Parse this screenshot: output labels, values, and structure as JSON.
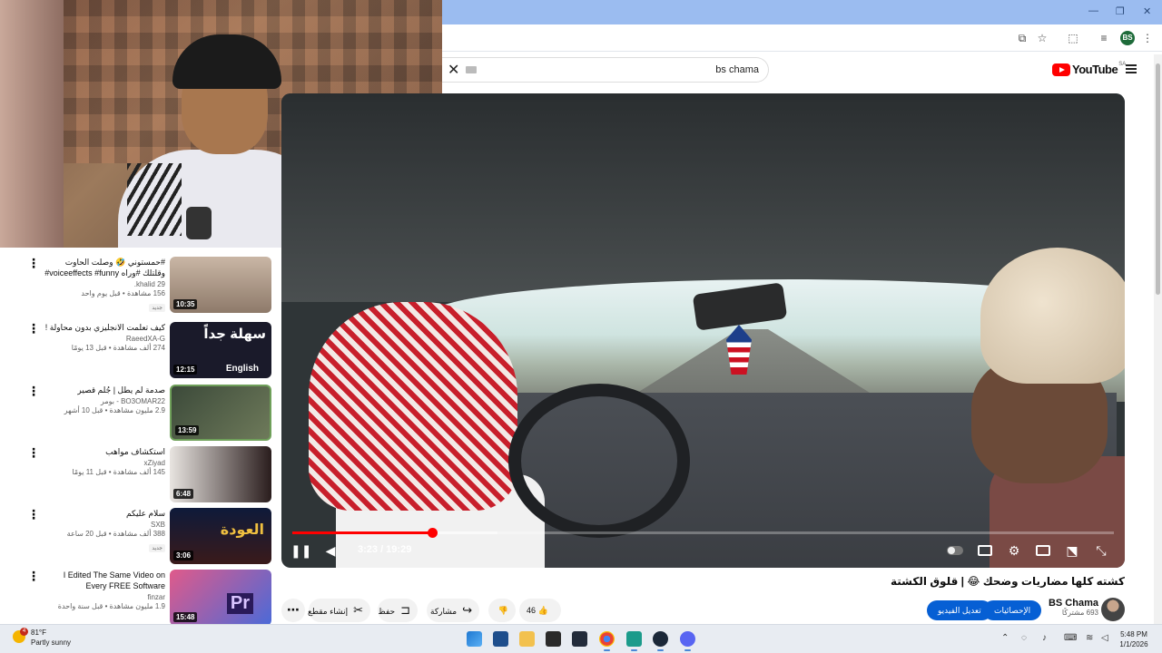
{
  "browser": {
    "window_controls": [
      "—",
      "❐",
      "✕"
    ],
    "profile_initials": "BS"
  },
  "youtube": {
    "search_query": "bs chama",
    "logo_text": "YouTube",
    "region": "SA"
  },
  "player": {
    "time": "3:23 / 19:29",
    "progress_fraction": 0.17,
    "buffer_fraction": 0.25
  },
  "video": {
    "title": "كشته كلها مضاريات وضحك 😂 | قلوق الكشتة",
    "like_count": "46",
    "share_label": "مشاركة",
    "save_label": "حفظ",
    "clip_label": "إنشاء مقطع",
    "channel_name": "BS Chama",
    "subscribers": "693 مشتركًا",
    "edit_button": "تعديل الفيديو",
    "analytics_button": "الإحصائيات"
  },
  "recommendations": [
    {
      "title": "#حمستوني 🤣 وصلت الحاوت وقلتلك #وراه voiceeffects #funny# ...",
      "channel": "khalid 29.",
      "views": "156 مشاهدة • قبل يوم واحد",
      "badge": "جديد",
      "duration": "10:35"
    },
    {
      "title": "كيف تعلمت الانجليزي بدون محاولة !",
      "channel": "RaeedXA-G",
      "views": "274 ألف مشاهدة • قبل 13 يومًا",
      "badge": "",
      "duration": "12:15",
      "thumb_text": "سهلة جداً",
      "thumb_sub": "English"
    },
    {
      "title": "صدمة لم يطل | جُلم قصير",
      "channel": "BO3OMAR22 - بومر",
      "views": "2.9 مليون مشاهدة • قبل 10 أشهر",
      "badge": "",
      "duration": "13:59"
    },
    {
      "title": "استكشاف مواهب",
      "channel": "xZiyad",
      "views": "145 ألف مشاهدة • قبل 11 يومًا",
      "badge": "",
      "duration": "6:48"
    },
    {
      "title": "سلام عليكم",
      "channel": "SXB",
      "views": "388 ألف مشاهدة • قبل 20 ساعة",
      "badge": "جديد",
      "duration": "3:06",
      "thumb_text": "العودة"
    },
    {
      "title": "I Edited The Same Video on Every FREE Software",
      "channel": "finzar",
      "views": "1.9 مليون مشاهدة • قبل سنة واحدة",
      "badge": "",
      "duration": "15:48",
      "thumb_text": "Pr"
    }
  ],
  "taskbar": {
    "weather_temp": "81°F",
    "weather_cond": "Partly sunny",
    "notification_count": "4",
    "time": "5:48 PM",
    "date": "1/1/2026"
  },
  "colors": {
    "yt_red": "#ff0000",
    "accent_blue": "#065fd4",
    "chrome_blue": "#9bbcf0"
  }
}
